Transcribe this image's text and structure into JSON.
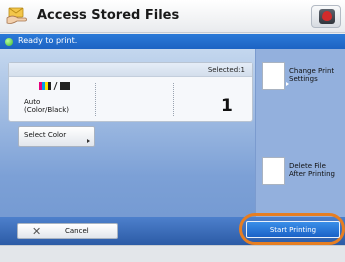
{
  "window": {
    "title": "Access Stored Files"
  },
  "status": {
    "message": "Ready to print."
  },
  "file_panel": {
    "selected": "Selected:1",
    "mode_line1": "Auto",
    "mode_line2": "(Color/Black)",
    "count": "1"
  },
  "buttons": {
    "select_color": "Select Color",
    "change_print_line1": "Change Print",
    "change_print_line2": "Settings",
    "delete_file_line1": "Delete File",
    "delete_file_line2": "After Printing",
    "cancel": "Cancel",
    "start_printing": "Start Printing"
  },
  "icons": {
    "app": "envelope-hand-icon",
    "home": "home-icon",
    "status": "ready-status-icon",
    "color_mode": "color-black-icon",
    "cancel": "close-icon"
  },
  "colors": {
    "status_bar": "#2b7ad8",
    "status_dot": "#39b52e",
    "start_button": "#1a61c7",
    "highlight": "#e67e22",
    "home_button": "#d22b2b"
  }
}
